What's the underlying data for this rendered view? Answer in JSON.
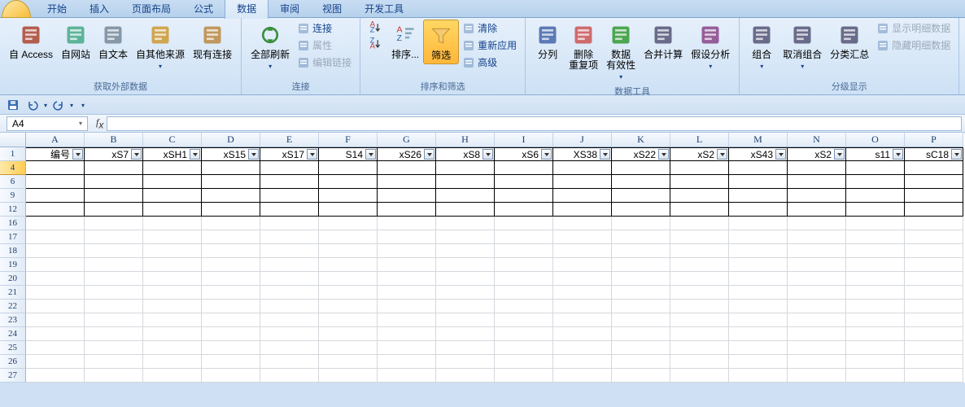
{
  "tabs": [
    "开始",
    "插入",
    "页面布局",
    "公式",
    "数据",
    "审阅",
    "视图",
    "开发工具"
  ],
  "activeTab": 4,
  "ribbon": {
    "groups": [
      {
        "label": "获取外部数据",
        "items": [
          {
            "t": "big",
            "label": "自 Access",
            "icon": "access"
          },
          {
            "t": "big",
            "label": "自网站",
            "icon": "web"
          },
          {
            "t": "big",
            "label": "自文本",
            "icon": "text"
          },
          {
            "t": "big",
            "label": "自其他来源",
            "icon": "other",
            "dd": true
          },
          {
            "t": "big",
            "label": "现有连接",
            "icon": "conn"
          }
        ]
      },
      {
        "label": "连接",
        "items": [
          {
            "t": "big",
            "label": "全部刷新",
            "icon": "refresh",
            "dd": true
          },
          {
            "t": "col",
            "items": [
              {
                "label": "连接",
                "icon": "link"
              },
              {
                "label": "属性",
                "icon": "prop",
                "disabled": true
              },
              {
                "label": "编辑链接",
                "icon": "edit",
                "disabled": true
              }
            ]
          }
        ]
      },
      {
        "label": "排序和筛选",
        "items": [
          {
            "t": "col",
            "items": [
              {
                "label": "",
                "icon": "az"
              },
              {
                "label": "",
                "icon": "za"
              }
            ]
          },
          {
            "t": "big",
            "label": "排序...",
            "icon": "sort"
          },
          {
            "t": "big",
            "label": "筛选",
            "icon": "funnel",
            "active": true
          },
          {
            "t": "col",
            "items": [
              {
                "label": "清除",
                "icon": "clear"
              },
              {
                "label": "重新应用",
                "icon": "reapply"
              },
              {
                "label": "高级",
                "icon": "adv"
              }
            ]
          }
        ]
      },
      {
        "label": "数据工具",
        "items": [
          {
            "t": "big",
            "label": "分列",
            "icon": "split"
          },
          {
            "t": "big",
            "label": "删除\n重复项",
            "icon": "dup"
          },
          {
            "t": "big",
            "label": "数据\n有效性",
            "icon": "valid",
            "dd": true
          },
          {
            "t": "big",
            "label": "合并计算",
            "icon": "consol"
          },
          {
            "t": "big",
            "label": "假设分析",
            "icon": "whatif",
            "dd": true
          }
        ]
      },
      {
        "label": "分级显示",
        "items": [
          {
            "t": "big",
            "label": "组合",
            "icon": "group",
            "dd": true
          },
          {
            "t": "big",
            "label": "取消组合",
            "icon": "ungroup",
            "dd": true
          },
          {
            "t": "big",
            "label": "分类汇总",
            "icon": "subtotal"
          },
          {
            "t": "col",
            "items": [
              {
                "label": "显示明细数据",
                "icon": "show",
                "disabled": true
              },
              {
                "label": "隐藏明细数据",
                "icon": "hide",
                "disabled": true
              }
            ]
          }
        ]
      }
    ]
  },
  "nameBox": "A4",
  "columns": [
    "A",
    "B",
    "C",
    "D",
    "E",
    "F",
    "G",
    "H",
    "I",
    "J",
    "K",
    "L",
    "M",
    "N",
    "O",
    "P"
  ],
  "rowNums": [
    1,
    4,
    6,
    9,
    12,
    16,
    17,
    18,
    19,
    20,
    21,
    22,
    23,
    24,
    25,
    26,
    27
  ],
  "headerRow": [
    "编号",
    "xS7",
    "xSH1",
    "xS15",
    "xS17",
    "S14",
    "xS26",
    "xS8",
    "xS6",
    "XS38",
    "xS22",
    "xS2",
    "xS43",
    "xS2",
    "s11",
    "sC18"
  ],
  "dataRows": 4
}
